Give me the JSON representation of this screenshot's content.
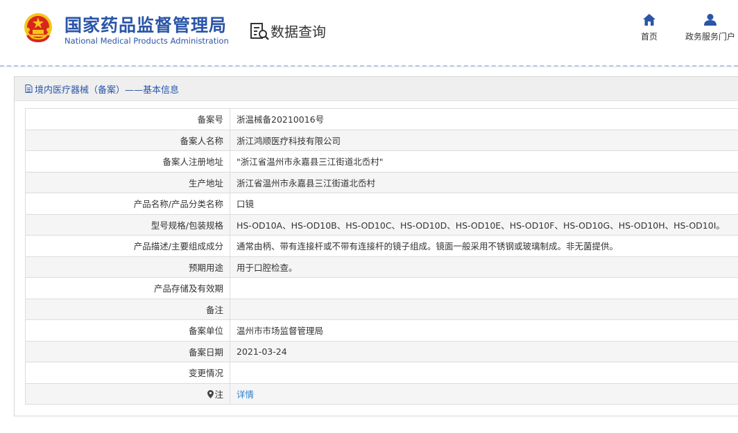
{
  "header": {
    "brand_cn": "国家药品监督管理局",
    "brand_en": "National Medical Products Administration",
    "query_title": "数据查询",
    "nav": [
      {
        "label": "首页",
        "icon": "home-icon"
      },
      {
        "label": "政务服务门户",
        "icon": "user-icon"
      }
    ]
  },
  "panel": {
    "title": "境内医疗器械（备案）——基本信息"
  },
  "rows": [
    {
      "label": "备案号",
      "value": "浙温械备20210016号"
    },
    {
      "label": "备案人名称",
      "value": "浙江鸿顺医疗科技有限公司"
    },
    {
      "label": "备案人注册地址",
      "value": "\"浙江省温州市永嘉县三江街道北岙村\""
    },
    {
      "label": "生产地址",
      "value": "浙江省温州市永嘉县三江街道北岙村"
    },
    {
      "label": "产品名称/产品分类名称",
      "value": "口镜"
    },
    {
      "label": "型号规格/包装规格",
      "value": "HS-OD10A、HS-OD10B、HS-OD10C、HS-OD10D、HS-OD10E、HS-OD10F、HS-OD10G、HS-OD10H、HS-OD10I。"
    },
    {
      "label": "产品描述/主要组成成分",
      "value": "通常由柄、带有连接杆或不带有连接杆的镜子组成。镜面一般采用不锈钢或玻璃制成。非无菌提供。"
    },
    {
      "label": "预期用途",
      "value": "用于口腔检查。"
    },
    {
      "label": "产品存储及有效期",
      "value": ""
    },
    {
      "label": "备注",
      "value": ""
    },
    {
      "label": "备案单位",
      "value": "温州市市场监督管理局"
    },
    {
      "label": "备案日期",
      "value": "2021-03-24"
    },
    {
      "label": "变更情况",
      "value": ""
    },
    {
      "label": "注",
      "value": "详情"
    }
  ],
  "colors": {
    "brand_blue": "#2a55a8",
    "link_blue": "#2a7fd0",
    "emblem_red": "#d9261c",
    "emblem_gold": "#f5c518"
  }
}
